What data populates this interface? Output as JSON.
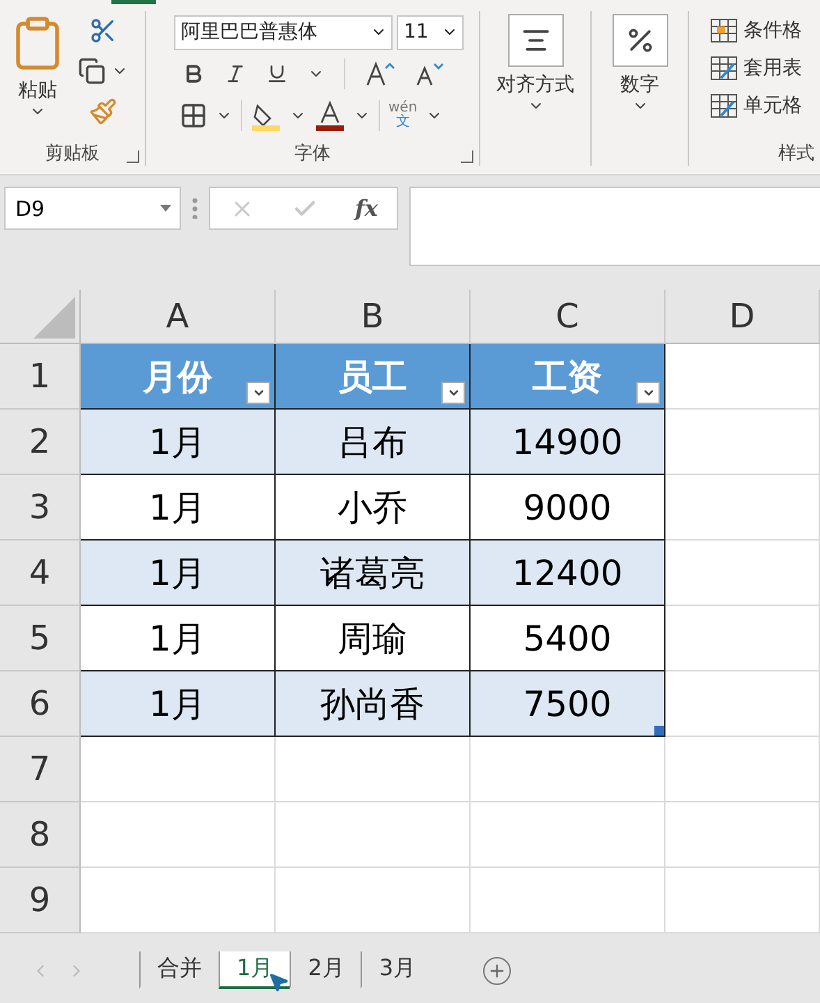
{
  "clipboard": {
    "paste": "粘贴",
    "label": "剪贴板"
  },
  "font": {
    "name": "阿里巴巴普惠体",
    "size": "11",
    "pinyin": "wén",
    "pinyin_char": "文",
    "label": "字体"
  },
  "alignment": {
    "label": "对齐方式"
  },
  "number": {
    "label": "数字"
  },
  "styles": {
    "items": [
      "条件格",
      "套用表",
      "单元格"
    ],
    "label": "样式"
  },
  "formula_bar": {
    "name_box": "D9",
    "fx": "fx"
  },
  "grid": {
    "columns": [
      "A",
      "B",
      "C",
      "D"
    ],
    "row_numbers": [
      "1",
      "2",
      "3",
      "4",
      "5",
      "6",
      "7",
      "8",
      "9"
    ],
    "table_header": [
      "月份",
      "员工",
      "工资"
    ],
    "table_rows": [
      [
        "1月",
        "吕布",
        "14900"
      ],
      [
        "1月",
        "小乔",
        "9000"
      ],
      [
        "1月",
        "诸葛亮",
        "12400"
      ],
      [
        "1月",
        "周瑜",
        "5400"
      ],
      [
        "1月",
        "孙尚香",
        "7500"
      ]
    ]
  },
  "sheets": [
    {
      "label": "合并",
      "selected": false
    },
    {
      "label": "1月",
      "selected": true
    },
    {
      "label": "2月",
      "selected": false
    },
    {
      "label": "3月",
      "selected": false
    }
  ]
}
